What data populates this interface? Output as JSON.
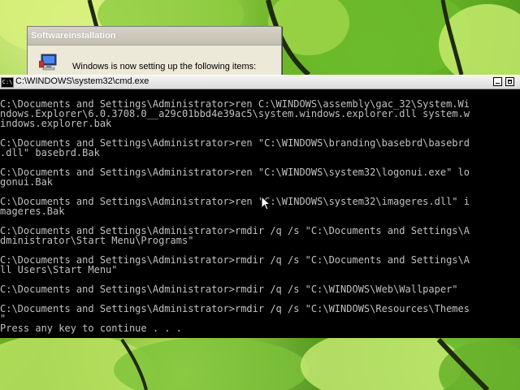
{
  "install_dialog": {
    "title": "Softwareinstallation",
    "message": "Windows is now setting up the following items:"
  },
  "cmd_window": {
    "title": "C:\\WINDOWS\\system32\\cmd.exe",
    "icon_label": "C:\\",
    "lines": [
      "C:\\Documents and Settings\\Administrator>ren C:\\WINDOWS\\assembly\\gac_32\\System.Wi",
      "ndows.Explorer\\6.0.3708.0__a29c01bbd4e39ac5\\system.windows.explorer.dll system.w",
      "indows.explorer.bak",
      "",
      "C:\\Documents and Settings\\Administrator>ren \"C:\\WINDOWS\\branding\\basebrd\\basebrd",
      ".dll\" basebrd.Bak",
      "",
      "C:\\Documents and Settings\\Administrator>ren \"C:\\WINDOWS\\system32\\logonui.exe\" lo",
      "gonui.Bak",
      "",
      "C:\\Documents and Settings\\Administrator>ren \"C:\\WINDOWS\\system32\\imageres.dll\" i",
      "mageres.Bak",
      "",
      "C:\\Documents and Settings\\Administrator>rmdir /q /s \"C:\\Documents and Settings\\A",
      "dministrator\\Start Menu\\Programs\"",
      "",
      "C:\\Documents and Settings\\Administrator>rmdir /q /s \"C:\\Documents and Settings\\A",
      "ll Users\\Start Menu\"",
      "",
      "C:\\Documents and Settings\\Administrator>rmdir /q /s \"C:\\WINDOWS\\Web\\Wallpaper\"",
      "",
      "C:\\Documents and Settings\\Administrator>rmdir /q /s \"C:\\WINDOWS\\Resources\\Themes",
      "\"",
      "Press any key to continue . . ."
    ]
  },
  "colors": {
    "console_bg": "#000000",
    "console_text": "#c0c0c0",
    "wallpaper_green": "#5aa61f"
  }
}
